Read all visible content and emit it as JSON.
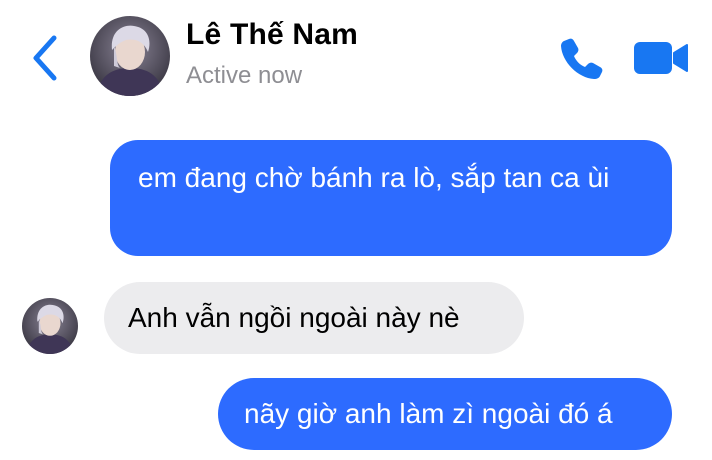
{
  "header": {
    "contact_name": "Lê Thế Nam",
    "status": "Active now",
    "back_icon": "chevron-left-icon",
    "call_icon": "phone-icon",
    "video_icon": "video-camera-icon",
    "accent_color": "#1877f2"
  },
  "messages": [
    {
      "direction": "outgoing",
      "text": "em đang chờ bánh ra lò, sắp tan ca ùi"
    },
    {
      "direction": "incoming",
      "text": "Anh vẫn ngồi ngoài này nè"
    },
    {
      "direction": "outgoing",
      "text": "nãy giờ anh làm zì ngoài đó á"
    }
  ],
  "colors": {
    "outgoing_bubble": "#2d6bff",
    "incoming_bubble": "#ececee",
    "status_text": "#8e8e93"
  }
}
